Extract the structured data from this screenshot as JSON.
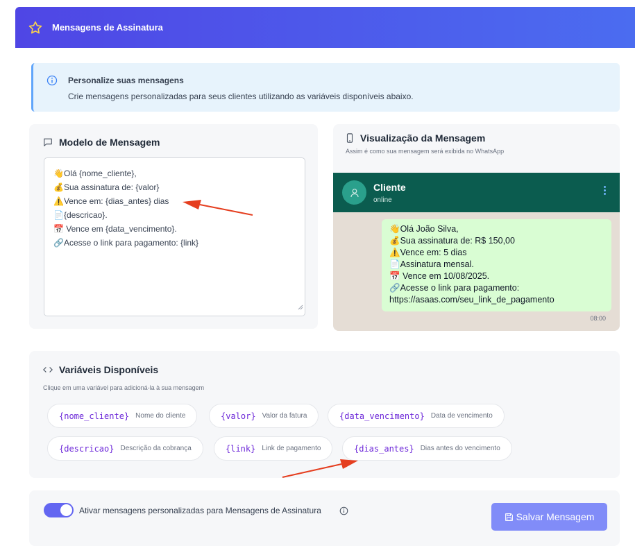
{
  "header": {
    "title": "Mensagens de Assinatura",
    "icon": "star-icon"
  },
  "info": {
    "title": "Personalize suas mensagens",
    "text": "Crie mensagens personalizadas para seus clientes utilizando as variáveis disponíveis abaixo."
  },
  "template": {
    "title": "Modelo de Mensagem",
    "lines": [
      "👋Olá {nome_cliente},",
      "💰Sua assinatura de: {valor}",
      "⚠️Vence em: {dias_antes} dias",
      "📄{descricao}.",
      "📅 Vence em {data_vencimento}.",
      "🔗Acesse o link para pagamento: {link}"
    ]
  },
  "preview": {
    "title": "Visualização da Mensagem",
    "subtitle": "Assim é como sua mensagem será exibida no WhatsApp",
    "contact_name": "Cliente",
    "contact_status": "online",
    "lines": [
      "👋Olá João Silva,",
      "💰Sua assinatura de: R$ 150,00",
      "⚠️Vence em: 5 dias",
      "📄Assinatura mensal.",
      "📅 Vence em 10/08/2025.",
      "🔗Acesse o link para pagamento:",
      "https://asaas.com/seu_link_de_pagamento"
    ],
    "time": "08:00"
  },
  "variables": {
    "title": "Variáveis Disponíveis",
    "subtitle": "Clique em uma variável para adicioná-la à sua mensagem",
    "chips": [
      {
        "code": "{nome_cliente}",
        "desc": "Nome do cliente"
      },
      {
        "code": "{valor}",
        "desc": "Valor da fatura"
      },
      {
        "code": "{data_vencimento}",
        "desc": "Data de vencimento"
      },
      {
        "code": "{descricao}",
        "desc": "Descrição da cobrança"
      },
      {
        "code": "{link}",
        "desc": "Link de pagamento"
      },
      {
        "code": "{dias_antes}",
        "desc": "Dias antes do vencimento"
      }
    ]
  },
  "footer": {
    "toggle_label": "Ativar mensagens personalizadas para Mensagens de Assinatura",
    "toggle_on": true,
    "save_label": "Salvar Mensagem"
  },
  "colors": {
    "header": "#4f46e5",
    "accent": "#6366f1",
    "whatsapp_header": "#0b5c4f",
    "bubble": "#d9fdd3",
    "variable_code": "#6d28d9",
    "annotation_arrow": "#e53e1f"
  }
}
